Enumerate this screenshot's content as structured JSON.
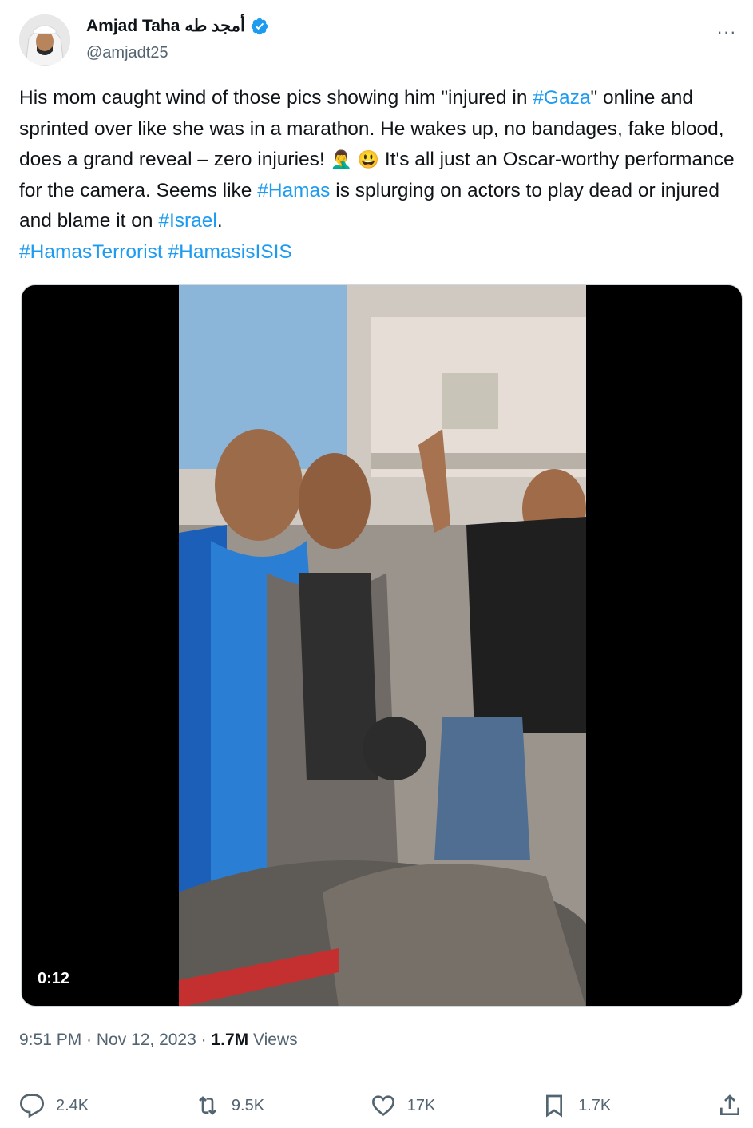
{
  "author": {
    "display_name": "Amjad Taha أمجد طه",
    "handle": "@amjadt25",
    "verified_icon": "verified-badge-icon",
    "more_label": "···"
  },
  "tweet": {
    "part1": "His mom caught wind of those pics showing him \"injured in ",
    "tag1": "#Gaza",
    "part2": "\" online and sprinted over like she was in a marathon. He wakes up, no bandages, fake blood, does a grand reveal – zero injuries! ",
    "emoji1": "🤦‍♂️",
    "emoji2": "😃",
    "part3": " It's all just an Oscar-worthy performance for the camera. Seems like ",
    "tag2": "#Hamas",
    "part4": " is splurging on actors to play dead or injured and blame it on ",
    "tag3": "#Israel",
    "part5": ". ",
    "tag4": "#HamasTerrorist",
    "tag5": "#HamasisISIS"
  },
  "media": {
    "duration": "0:12"
  },
  "meta": {
    "time_date": "9:51 PM · Nov 12, 2023 · ",
    "views_count": "1.7M",
    "views_label": " Views"
  },
  "actions": {
    "replies": "2.4K",
    "reposts": "9.5K",
    "likes": "17K",
    "bookmarks": "1.7K"
  }
}
